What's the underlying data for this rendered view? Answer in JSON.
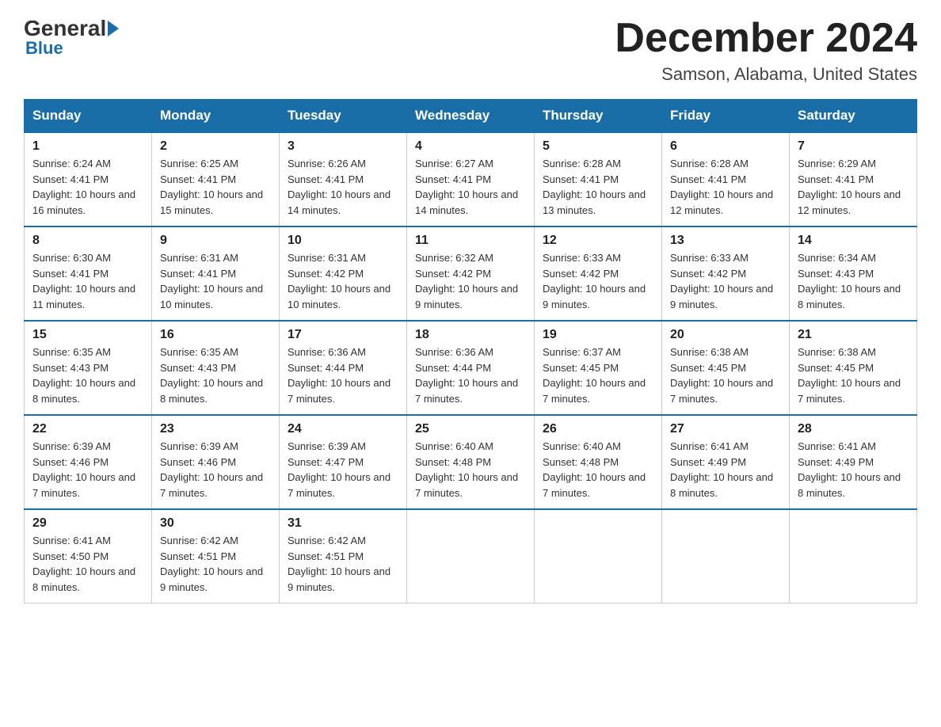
{
  "header": {
    "logo": {
      "general": "General",
      "blue": "Blue"
    },
    "title": "December 2024",
    "location": "Samson, Alabama, United States"
  },
  "days_of_week": [
    "Sunday",
    "Monday",
    "Tuesday",
    "Wednesday",
    "Thursday",
    "Friday",
    "Saturday"
  ],
  "weeks": [
    [
      {
        "day": "1",
        "sunrise": "6:24 AM",
        "sunset": "4:41 PM",
        "daylight": "10 hours and 16 minutes."
      },
      {
        "day": "2",
        "sunrise": "6:25 AM",
        "sunset": "4:41 PM",
        "daylight": "10 hours and 15 minutes."
      },
      {
        "day": "3",
        "sunrise": "6:26 AM",
        "sunset": "4:41 PM",
        "daylight": "10 hours and 14 minutes."
      },
      {
        "day": "4",
        "sunrise": "6:27 AM",
        "sunset": "4:41 PM",
        "daylight": "10 hours and 14 minutes."
      },
      {
        "day": "5",
        "sunrise": "6:28 AM",
        "sunset": "4:41 PM",
        "daylight": "10 hours and 13 minutes."
      },
      {
        "day": "6",
        "sunrise": "6:28 AM",
        "sunset": "4:41 PM",
        "daylight": "10 hours and 12 minutes."
      },
      {
        "day": "7",
        "sunrise": "6:29 AM",
        "sunset": "4:41 PM",
        "daylight": "10 hours and 12 minutes."
      }
    ],
    [
      {
        "day": "8",
        "sunrise": "6:30 AM",
        "sunset": "4:41 PM",
        "daylight": "10 hours and 11 minutes."
      },
      {
        "day": "9",
        "sunrise": "6:31 AM",
        "sunset": "4:41 PM",
        "daylight": "10 hours and 10 minutes."
      },
      {
        "day": "10",
        "sunrise": "6:31 AM",
        "sunset": "4:42 PM",
        "daylight": "10 hours and 10 minutes."
      },
      {
        "day": "11",
        "sunrise": "6:32 AM",
        "sunset": "4:42 PM",
        "daylight": "10 hours and 9 minutes."
      },
      {
        "day": "12",
        "sunrise": "6:33 AM",
        "sunset": "4:42 PM",
        "daylight": "10 hours and 9 minutes."
      },
      {
        "day": "13",
        "sunrise": "6:33 AM",
        "sunset": "4:42 PM",
        "daylight": "10 hours and 9 minutes."
      },
      {
        "day": "14",
        "sunrise": "6:34 AM",
        "sunset": "4:43 PM",
        "daylight": "10 hours and 8 minutes."
      }
    ],
    [
      {
        "day": "15",
        "sunrise": "6:35 AM",
        "sunset": "4:43 PM",
        "daylight": "10 hours and 8 minutes."
      },
      {
        "day": "16",
        "sunrise": "6:35 AM",
        "sunset": "4:43 PM",
        "daylight": "10 hours and 8 minutes."
      },
      {
        "day": "17",
        "sunrise": "6:36 AM",
        "sunset": "4:44 PM",
        "daylight": "10 hours and 7 minutes."
      },
      {
        "day": "18",
        "sunrise": "6:36 AM",
        "sunset": "4:44 PM",
        "daylight": "10 hours and 7 minutes."
      },
      {
        "day": "19",
        "sunrise": "6:37 AM",
        "sunset": "4:45 PM",
        "daylight": "10 hours and 7 minutes."
      },
      {
        "day": "20",
        "sunrise": "6:38 AM",
        "sunset": "4:45 PM",
        "daylight": "10 hours and 7 minutes."
      },
      {
        "day": "21",
        "sunrise": "6:38 AM",
        "sunset": "4:45 PM",
        "daylight": "10 hours and 7 minutes."
      }
    ],
    [
      {
        "day": "22",
        "sunrise": "6:39 AM",
        "sunset": "4:46 PM",
        "daylight": "10 hours and 7 minutes."
      },
      {
        "day": "23",
        "sunrise": "6:39 AM",
        "sunset": "4:46 PM",
        "daylight": "10 hours and 7 minutes."
      },
      {
        "day": "24",
        "sunrise": "6:39 AM",
        "sunset": "4:47 PM",
        "daylight": "10 hours and 7 minutes."
      },
      {
        "day": "25",
        "sunrise": "6:40 AM",
        "sunset": "4:48 PM",
        "daylight": "10 hours and 7 minutes."
      },
      {
        "day": "26",
        "sunrise": "6:40 AM",
        "sunset": "4:48 PM",
        "daylight": "10 hours and 7 minutes."
      },
      {
        "day": "27",
        "sunrise": "6:41 AM",
        "sunset": "4:49 PM",
        "daylight": "10 hours and 8 minutes."
      },
      {
        "day": "28",
        "sunrise": "6:41 AM",
        "sunset": "4:49 PM",
        "daylight": "10 hours and 8 minutes."
      }
    ],
    [
      {
        "day": "29",
        "sunrise": "6:41 AM",
        "sunset": "4:50 PM",
        "daylight": "10 hours and 8 minutes."
      },
      {
        "day": "30",
        "sunrise": "6:42 AM",
        "sunset": "4:51 PM",
        "daylight": "10 hours and 9 minutes."
      },
      {
        "day": "31",
        "sunrise": "6:42 AM",
        "sunset": "4:51 PM",
        "daylight": "10 hours and 9 minutes."
      },
      null,
      null,
      null,
      null
    ]
  ]
}
